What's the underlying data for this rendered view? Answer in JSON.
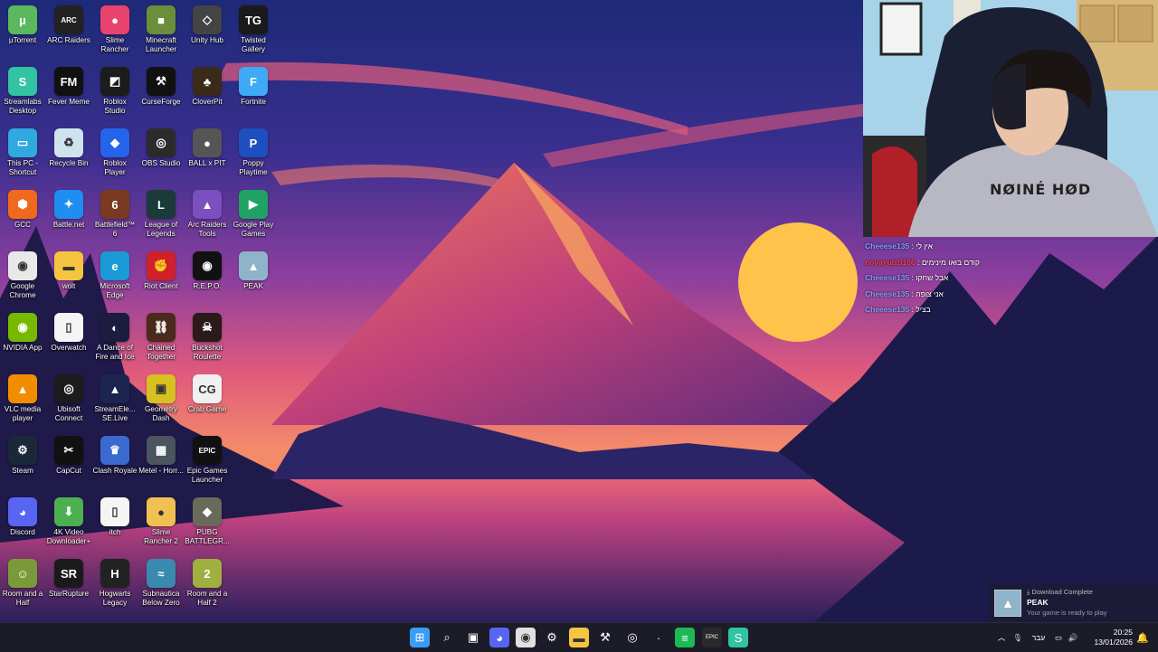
{
  "desktop": {
    "icons": [
      {
        "label": "µTorrent",
        "col": 0,
        "row": 0,
        "color": "#5cb85c",
        "glyph": "µ"
      },
      {
        "label": "ARC Raiders",
        "col": 1,
        "row": 0,
        "color": "#222222",
        "glyph": "ARC"
      },
      {
        "label": "Slime Rancher",
        "col": 2,
        "row": 0,
        "color": "#e8436e",
        "glyph": "●"
      },
      {
        "label": "Minecraft Launcher",
        "col": 3,
        "row": 0,
        "color": "#6b8e3a",
        "glyph": "■"
      },
      {
        "label": "Unity Hub",
        "col": 4,
        "row": 0,
        "color": "#444444",
        "glyph": "◇"
      },
      {
        "label": "Twisted Gallery",
        "col": 5,
        "row": 0,
        "color": "#1a1a1a",
        "glyph": "TG"
      },
      {
        "label": "Streamlabs Desktop",
        "col": 0,
        "row": 1,
        "color": "#31c3a2",
        "glyph": "S"
      },
      {
        "label": "Fever Meme",
        "col": 1,
        "row": 1,
        "color": "#111111",
        "glyph": "FM"
      },
      {
        "label": "Roblox Studio",
        "col": 2,
        "row": 1,
        "color": "#1c1c1c",
        "glyph": "◩"
      },
      {
        "label": "CurseForge",
        "col": 3,
        "row": 1,
        "color": "#111111",
        "glyph": "⚒"
      },
      {
        "label": "CloverPit",
        "col": 4,
        "row": 1,
        "color": "#3a2a1a",
        "glyph": "♣"
      },
      {
        "label": "Fortnite",
        "col": 5,
        "row": 1,
        "color": "#3ea9f5",
        "glyph": "F"
      },
      {
        "label": "This PC - Shortcut",
        "col": 0,
        "row": 2,
        "color": "#2fa9e0",
        "glyph": "▭"
      },
      {
        "label": "Recycle Bin",
        "col": 1,
        "row": 2,
        "color": "#cfe3ef",
        "glyph": "♻"
      },
      {
        "label": "Roblox Player",
        "col": 2,
        "row": 2,
        "color": "#2563eb",
        "glyph": "◆"
      },
      {
        "label": "OBS Studio",
        "col": 3,
        "row": 2,
        "color": "#2b2b2b",
        "glyph": "◎"
      },
      {
        "label": "BALL x PIT",
        "col": 4,
        "row": 2,
        "color": "#555555",
        "glyph": "●"
      },
      {
        "label": "Poppy Playtime",
        "col": 5,
        "row": 2,
        "color": "#1e4fbf",
        "glyph": "P"
      },
      {
        "label": "GCC",
        "col": 0,
        "row": 3,
        "color": "#f06a1d",
        "glyph": "⬢"
      },
      {
        "label": "Battle.net",
        "col": 1,
        "row": 3,
        "color": "#1f8ef1",
        "glyph": "✦"
      },
      {
        "label": "Battlefield™ 6",
        "col": 2,
        "row": 3,
        "color": "#7a3a22",
        "glyph": "6"
      },
      {
        "label": "League of Legends",
        "col": 3,
        "row": 3,
        "color": "#1b3a3a",
        "glyph": "L"
      },
      {
        "label": "Arc Raiders Tools",
        "col": 4,
        "row": 3,
        "color": "#7b4fbf",
        "glyph": "▲"
      },
      {
        "label": "Google Play Games",
        "col": 5,
        "row": 3,
        "color": "#1ea362",
        "glyph": "▶"
      },
      {
        "label": "Google Chrome",
        "col": 0,
        "row": 4,
        "color": "#e8e8e8",
        "glyph": "◉"
      },
      {
        "label": "wolt",
        "col": 1,
        "row": 4,
        "color": "#f5c542",
        "glyph": "▬"
      },
      {
        "label": "Microsoft Edge",
        "col": 2,
        "row": 4,
        "color": "#1a9ad6",
        "glyph": "e"
      },
      {
        "label": "Riot Client",
        "col": 3,
        "row": 4,
        "color": "#d0202a",
        "glyph": "✊"
      },
      {
        "label": "R.E.P.O.",
        "col": 4,
        "row": 4,
        "color": "#111111",
        "glyph": "◉"
      },
      {
        "label": "PEAK",
        "col": 5,
        "row": 4,
        "color": "#8fb3c9",
        "glyph": "▲"
      },
      {
        "label": "NVIDIA App",
        "col": 0,
        "row": 5,
        "color": "#76b900",
        "glyph": "◉"
      },
      {
        "label": "Overwatch",
        "col": 1,
        "row": 5,
        "color": "#f5f5f5",
        "glyph": "▯"
      },
      {
        "label": "A Dance of Fire and Ice",
        "col": 2,
        "row": 5,
        "color": "#1c1c40",
        "glyph": "◐"
      },
      {
        "label": "Chained Together",
        "col": 3,
        "row": 5,
        "color": "#4a2a1a",
        "glyph": "⛓"
      },
      {
        "label": "Buckshot Roulette",
        "col": 4,
        "row": 5,
        "color": "#2a1a1a",
        "glyph": "☠"
      },
      {
        "label": "VLC media player",
        "col": 0,
        "row": 6,
        "color": "#f28c00",
        "glyph": "▲"
      },
      {
        "label": "Ubisoft Connect",
        "col": 1,
        "row": 6,
        "color": "#1c1c1c",
        "glyph": "◎"
      },
      {
        "label": "StreamEle... SE.Live",
        "col": 2,
        "row": 6,
        "color": "#1c2550",
        "glyph": "▲"
      },
      {
        "label": "Geometry Dash",
        "col": 3,
        "row": 6,
        "color": "#d8c020",
        "glyph": "▣"
      },
      {
        "label": "Crab Game",
        "col": 4,
        "row": 6,
        "color": "#f0f0f0",
        "glyph": "CG"
      },
      {
        "label": "Steam",
        "col": 0,
        "row": 7,
        "color": "#1b2838",
        "glyph": "⚙"
      },
      {
        "label": "CapCut",
        "col": 1,
        "row": 7,
        "color": "#111111",
        "glyph": "✂"
      },
      {
        "label": "Clash Royale",
        "col": 2,
        "row": 7,
        "color": "#3a6ad0",
        "glyph": "♛"
      },
      {
        "label": "Metel - Horr...",
        "col": 3,
        "row": 7,
        "color": "#4a5560",
        "glyph": "▦"
      },
      {
        "label": "Epic Games Launcher",
        "col": 4,
        "row": 7,
        "color": "#111111",
        "glyph": "EPIC"
      },
      {
        "label": "Discord",
        "col": 0,
        "row": 8,
        "color": "#5865f2",
        "glyph": "◕"
      },
      {
        "label": "4K Video Downloader+",
        "col": 1,
        "row": 8,
        "color": "#4caf50",
        "glyph": "⬇"
      },
      {
        "label": "itch",
        "col": 2,
        "row": 8,
        "color": "#f5f5f5",
        "glyph": "▯"
      },
      {
        "label": "Slime Rancher 2",
        "col": 3,
        "row": 8,
        "color": "#f0c050",
        "glyph": "●"
      },
      {
        "label": "PUBG BATTLEGR...",
        "col": 4,
        "row": 8,
        "color": "#6a6a5a",
        "glyph": "◆"
      },
      {
        "label": "Room and a Half",
        "col": 0,
        "row": 9,
        "color": "#7a9a3a",
        "glyph": "☺"
      },
      {
        "label": "StarRupture",
        "col": 1,
        "row": 9,
        "color": "#1a1a1a",
        "glyph": "SR"
      },
      {
        "label": "Hogwarts Legacy",
        "col": 2,
        "row": 9,
        "color": "#222222",
        "glyph": "H"
      },
      {
        "label": "Subnautica Below Zero",
        "col": 3,
        "row": 9,
        "color": "#3a8ab0",
        "glyph": "≈"
      },
      {
        "label": "Room and a Half 2",
        "col": 4,
        "row": 9,
        "color": "#a0b040",
        "glyph": "2"
      }
    ]
  },
  "chat": {
    "messages": [
      {
        "user": "Cheeese135",
        "text": "אין לי",
        "highlight": false
      },
      {
        "user": "noyayubzi166",
        "text": "קודם בואו מינימים",
        "highlight": true
      },
      {
        "user": "Cheeese135",
        "text": "אבל שחקו",
        "highlight": false
      },
      {
        "user": "Cheeese135",
        "text": "אני צופה",
        "highlight": false
      },
      {
        "user": "Cheeese135",
        "text": "בציל",
        "highlight": false
      }
    ]
  },
  "webcam": {
    "shirt_text": "NØINÉ HØD"
  },
  "notification": {
    "header": "Download Complete",
    "title": "PEAK",
    "body": "Your game is ready to play"
  },
  "taskbar": {
    "apps": [
      {
        "name": "start",
        "color": "#3b9cf5",
        "glyph": "⊞"
      },
      {
        "name": "search",
        "color": "transparent",
        "glyph": "⌕"
      },
      {
        "name": "task-view",
        "color": "transparent",
        "glyph": "▣"
      },
      {
        "name": "discord",
        "color": "#5865f2",
        "glyph": "◕"
      },
      {
        "name": "chrome",
        "color": "#e0e0e0",
        "glyph": "◉"
      },
      {
        "name": "steam",
        "color": "transparent",
        "glyph": "⚙"
      },
      {
        "name": "file-explorer",
        "color": "#f5c542",
        "glyph": "▬"
      },
      {
        "name": "curseforge",
        "color": "transparent",
        "glyph": "⚒"
      },
      {
        "name": "obs",
        "color": "transparent",
        "glyph": "◎"
      },
      {
        "name": "unknown",
        "color": "transparent",
        "glyph": "·"
      },
      {
        "name": "spotify",
        "color": "#1db954",
        "glyph": "≡"
      },
      {
        "name": "epic",
        "color": "#2a2a2a",
        "glyph": "EPIC"
      },
      {
        "name": "streamlabs",
        "color": "#31c3a2",
        "glyph": "S"
      }
    ],
    "language": "עבר",
    "time": "20:25",
    "date": "13/01/2026"
  }
}
